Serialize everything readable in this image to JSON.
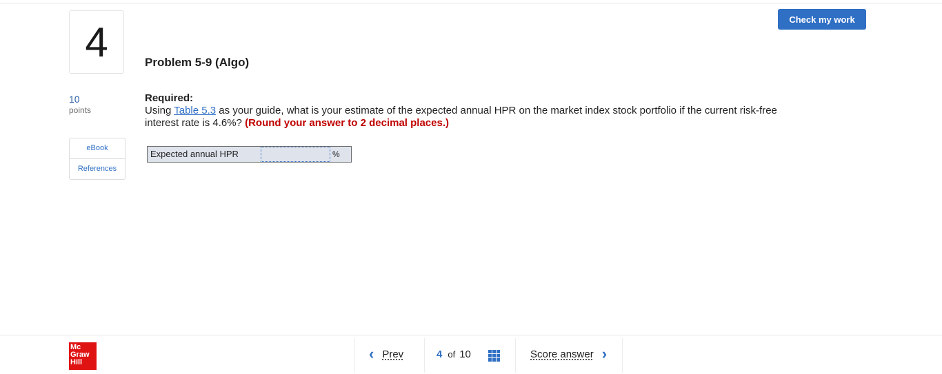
{
  "header": {
    "question_number": "4",
    "check_button": "Check my work"
  },
  "problem": {
    "title": "Problem 5-9 (Algo)",
    "points_value": "10",
    "points_label": "points",
    "required_label": "Required:",
    "text_before_link": "Using ",
    "link_text": "Table 5.3",
    "text_after_link": " as your guide, what is your estimate of the expected annual HPR on the market index stock portfolio if the current risk-free interest rate is 4.6%? ",
    "emphasis": "(Round your answer to 2 decimal places.)"
  },
  "resources": {
    "items": [
      "eBook",
      "References"
    ]
  },
  "answer": {
    "label": "Expected annual HPR",
    "value": "",
    "unit": "%"
  },
  "footer": {
    "logo_lines": [
      "Mc",
      "Graw",
      "Hill"
    ],
    "prev_label": "Prev",
    "current_page": "4",
    "of_label": "of",
    "total_pages": "10",
    "score_label": "Score answer"
  },
  "colors": {
    "accent": "#2f6fc4",
    "emphasis": "#c00000",
    "logo": "#e01313"
  },
  "icons": [
    "chevron-left-icon",
    "grid-icon",
    "chevron-right-icon"
  ]
}
